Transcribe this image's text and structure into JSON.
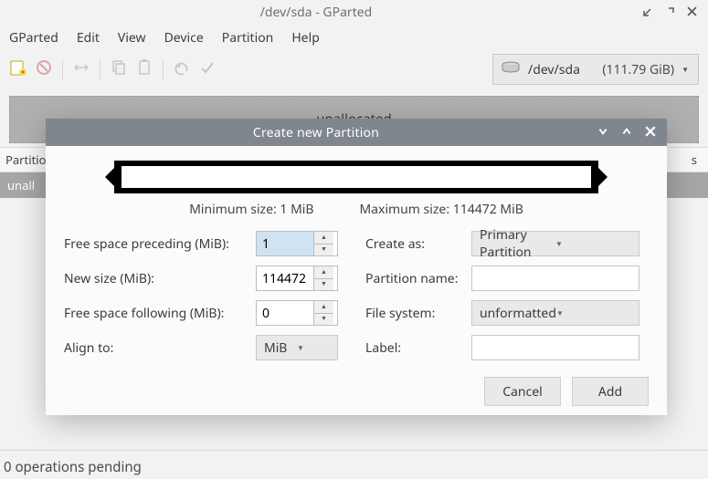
{
  "window": {
    "title": "/dev/sda - GParted"
  },
  "menu": [
    "GParted",
    "Edit",
    "View",
    "Device",
    "Partition",
    "Help"
  ],
  "device_selector": {
    "name": "/dev/sda",
    "size": "(111.79 GiB)"
  },
  "partition_graphic_label": "unallocated",
  "table": {
    "col_first": "Partitio",
    "col_last": "s",
    "row_label": "unall"
  },
  "statusbar": "0 operations pending",
  "dialog": {
    "title": "Create new Partition",
    "min_size": "Minimum size: 1 MiB",
    "max_size": "Maximum size: 114472 MiB",
    "labels": {
      "free_preceding": "Free space preceding (MiB):",
      "new_size": "New size (MiB):",
      "free_following": "Free space following (MiB):",
      "align_to": "Align to:",
      "create_as": "Create as:",
      "partition_name": "Partition name:",
      "file_system": "File system:",
      "label": "Label:"
    },
    "values": {
      "free_preceding": "1",
      "new_size": "114472",
      "free_following": "0",
      "align_to": "MiB",
      "create_as": "Primary Partition",
      "partition_name": "",
      "file_system": "unformatted",
      "label": ""
    },
    "buttons": {
      "cancel": "Cancel",
      "add": "Add"
    }
  }
}
